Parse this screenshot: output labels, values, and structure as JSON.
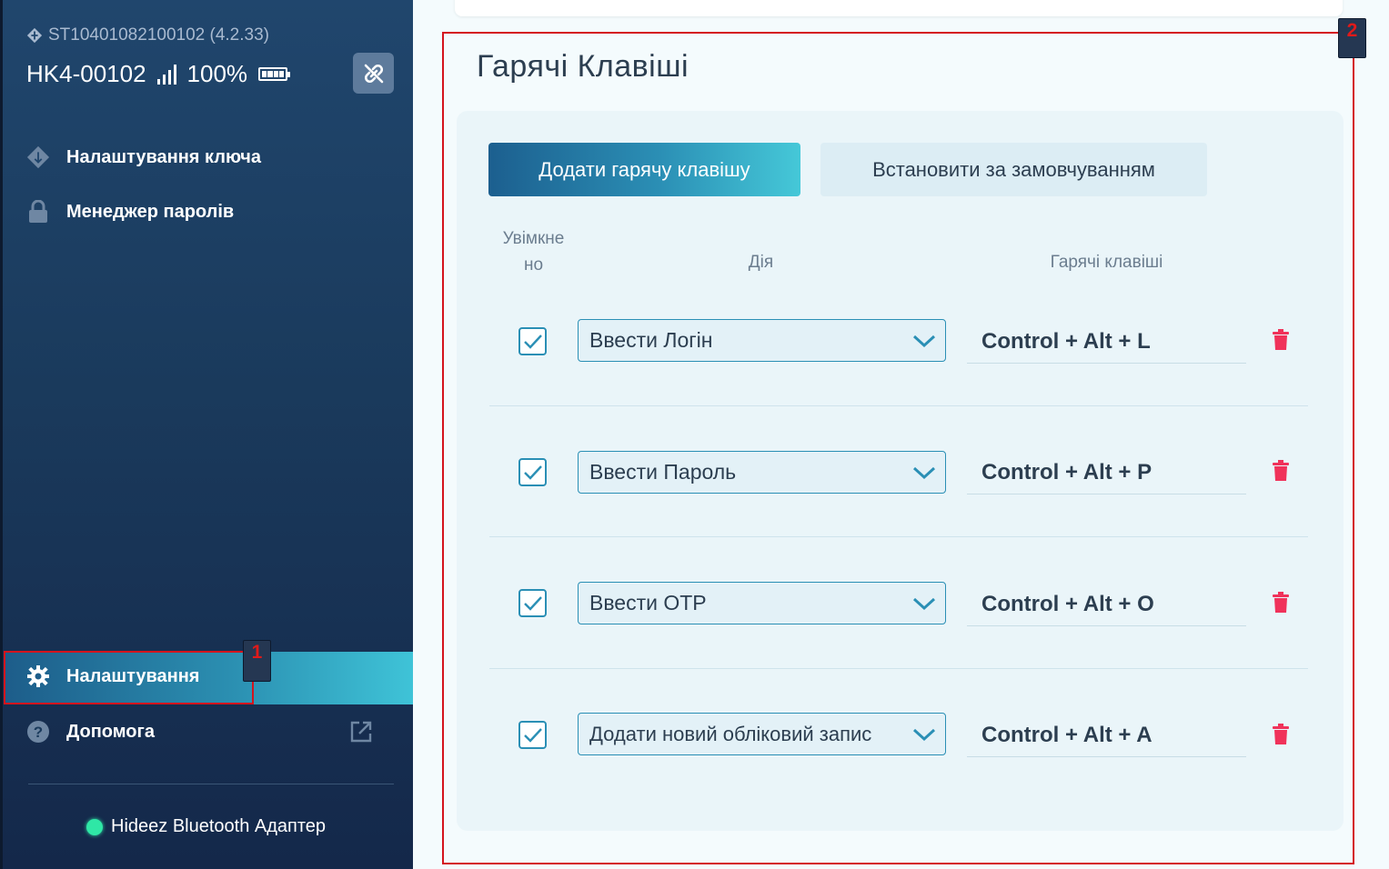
{
  "sidebar": {
    "device_id": "ST10401082100102 (4.2.33)",
    "device_name": "HK4-00102",
    "battery": "100%",
    "nav": {
      "key_settings": "Налаштування ключа",
      "password_manager": "Менеджер паролів",
      "settings": "Налаштування",
      "help": "Допомога"
    },
    "adapter": "Hideez Bluetooth Адаптер"
  },
  "main": {
    "title": "Гарячі Клавіші",
    "add_button": "Додати гарячу клавішу",
    "default_button": "Встановити за замовчуванням",
    "columns": {
      "enabled_line1": "Увімкне",
      "enabled_line2": "но",
      "action": "Дія",
      "hotkeys": "Гарячі клавіші"
    },
    "rows": [
      {
        "enabled": true,
        "action": "Ввести Логін",
        "hotkey": "Control + Alt + L"
      },
      {
        "enabled": true,
        "action": "Ввести Пароль",
        "hotkey": "Control + Alt + P"
      },
      {
        "enabled": true,
        "action": "Ввести OTP",
        "hotkey": "Control + Alt + O"
      },
      {
        "enabled": true,
        "action": "Додати новий обліковий запис",
        "hotkey": "Control + Alt + A"
      }
    ]
  },
  "annotations": {
    "box1": "1",
    "box2": "2"
  },
  "colors": {
    "accent": "#2a8fb5",
    "delete": "#f0325a",
    "online": "#2fe7a6",
    "annotation": "#d4141d"
  }
}
